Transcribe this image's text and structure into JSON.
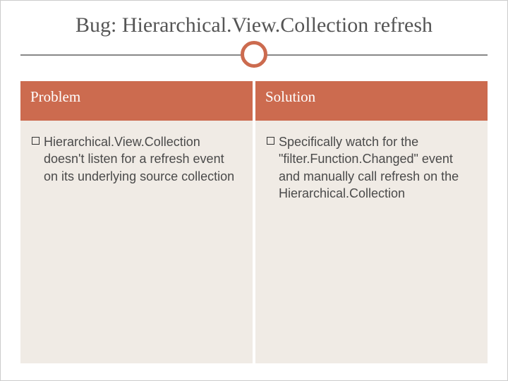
{
  "title": "Bug: Hierarchical.View.Collection refresh",
  "columns": {
    "left": {
      "header": "Problem",
      "bullet": "Hierarchical.View.Collection doesn't listen for a refresh event on its underlying source collection"
    },
    "right": {
      "header": "Solution",
      "bullet": "Specifically watch for the \"filter.Function.Changed\" event and manually call refresh on the Hierarchical.Collection"
    }
  }
}
